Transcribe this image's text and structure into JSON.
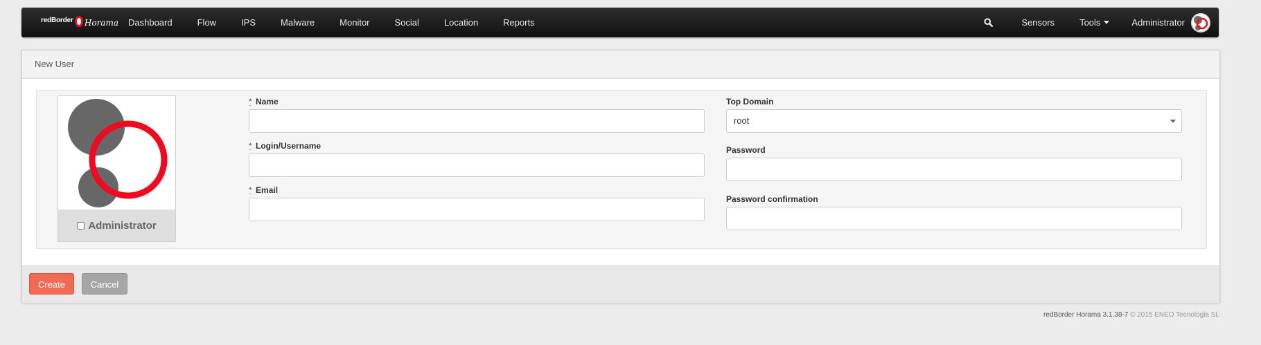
{
  "navbar": {
    "brand": {
      "part1": "redBorder",
      "part2": "Horama"
    },
    "items": [
      {
        "label": "Dashboard"
      },
      {
        "label": "Flow"
      },
      {
        "label": "IPS"
      },
      {
        "label": "Malware"
      },
      {
        "label": "Monitor"
      },
      {
        "label": "Social"
      },
      {
        "label": "Location"
      },
      {
        "label": "Reports"
      }
    ],
    "search_icon": "search-icon",
    "sensors_label": "Sensors",
    "tools_label": "Tools",
    "user_label": "Administrator"
  },
  "panel": {
    "title": "New User",
    "avatar": {
      "label": "Administrator",
      "checked": false
    },
    "form": {
      "required_mark": "*",
      "name": {
        "label": "Name",
        "value": ""
      },
      "login": {
        "label": "Login/Username",
        "value": ""
      },
      "email": {
        "label": "Email",
        "value": ""
      },
      "top_domain": {
        "label": "Top Domain",
        "value": "root"
      },
      "password": {
        "label": "Password",
        "value": ""
      },
      "password_confirmation": {
        "label": "Password confirmation",
        "value": ""
      }
    },
    "buttons": {
      "create": "Create",
      "cancel": "Cancel"
    }
  },
  "footer": {
    "version": "redBorder Horama 3.1.38-7",
    "copyright": "© 2015 ENEO Tecnologia SL"
  },
  "colors": {
    "brand_red": "#e0131f",
    "create_button": "#f16a54",
    "cancel_button": "#a6a6a6",
    "navbar": "#1a1a1a"
  }
}
